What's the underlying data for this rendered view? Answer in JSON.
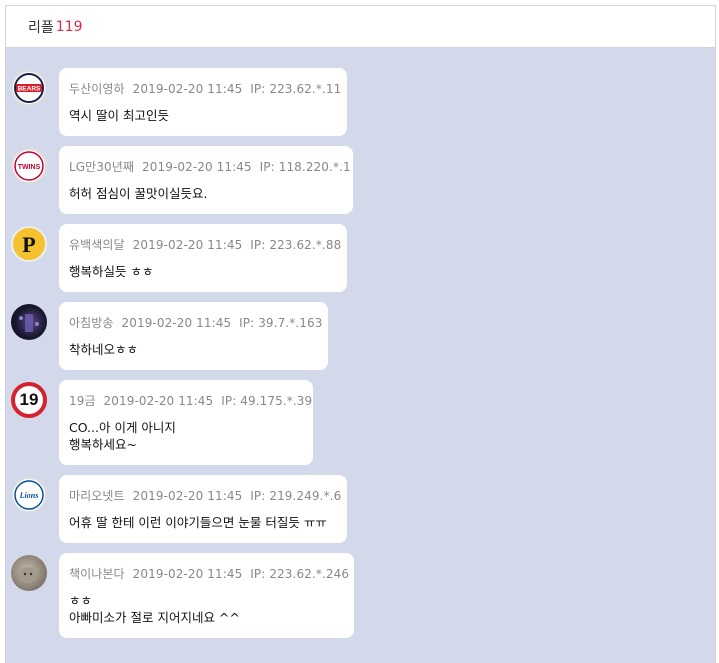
{
  "header": {
    "label": "리플",
    "count": "119"
  },
  "comments": [
    {
      "nick": "두산이영하",
      "date": "2019-02-20 11:45",
      "ip": "IP: 223.62.*.11",
      "text": "역시 딸이 최고인듯",
      "avatar": "bears-logo-icon"
    },
    {
      "nick": "LG만30년째",
      "date": "2019-02-20 11:45",
      "ip": "IP: 118.220.*.1",
      "text": "허허 점심이 꿀맛이실듯요.",
      "avatar": "twins-logo-icon"
    },
    {
      "nick": "유백색의달",
      "date": "2019-02-20 11:45",
      "ip": "IP: 223.62.*.88",
      "text": "행복하실듯 ㅎㅎ",
      "avatar": "pirates-logo-icon"
    },
    {
      "nick": "아침방송",
      "date": "2019-02-20 11:45",
      "ip": "IP: 39.7.*.163",
      "text": "착하네오ㅎㅎ",
      "avatar": "night-photo-icon"
    },
    {
      "nick": "19금",
      "date": "2019-02-20 11:45",
      "ip": "IP: 49.175.*.39",
      "text": "CO...아 이게 아니지\n행복하세요~",
      "avatar": "nineteen-sign-icon"
    },
    {
      "nick": "마리오넷트",
      "date": "2019-02-20 11:45",
      "ip": "IP: 219.249.*.6",
      "text": "어휴 딸 한테 이런 이야기들으면 눈물 터질듯 ㅠㅠ",
      "avatar": "lions-logo-icon"
    },
    {
      "nick": "책이나본다",
      "date": "2019-02-20 11:45",
      "ip": "IP: 223.62.*.246",
      "text": "ㅎㅎ\n아빠미소가 절로 지어지네요 ^^",
      "avatar": "cat-photo-icon"
    }
  ],
  "icons": {
    "bears_text": "BEARS",
    "twins_text": "TWINS",
    "pirates_text": "P",
    "nineteen_text": "19",
    "lions_text": "Lions"
  },
  "colors": {
    "background": "#d3d9eb",
    "count": "#e0284a",
    "bubble": "#ffffff"
  }
}
